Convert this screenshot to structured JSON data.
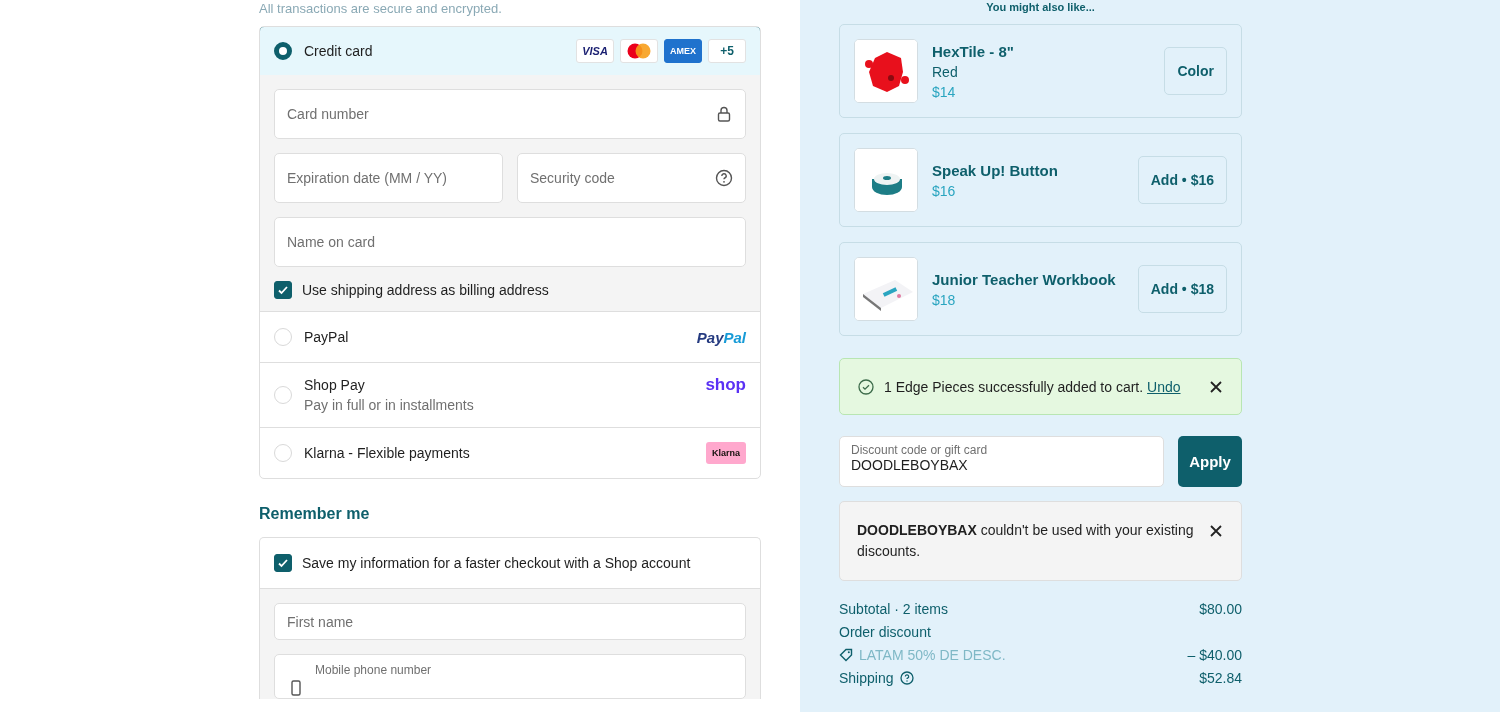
{
  "security_note": "All transactions are secure and encrypted.",
  "payment_methods": [
    {
      "kind": "card",
      "label": "Credit card",
      "selected": true,
      "brands": [
        {
          "kind": "visa",
          "label": "VISA"
        },
        {
          "kind": "mastercard"
        },
        {
          "kind": "amex",
          "label": "AMEX"
        },
        {
          "kind": "more",
          "label": "+5"
        }
      ],
      "fields": [
        [
          {
            "placeholder": "Card number"
          }
        ],
        [
          {
            "placeholder": "Expiration date (MM / YY)"
          },
          {
            "placeholder": "Security code"
          }
        ],
        [
          {
            "placeholder": "Name on card"
          }
        ]
      ],
      "billing_checkbox": {
        "label": "Use shipping address as billing address",
        "checked": true
      }
    },
    {
      "kind": "paypal",
      "label": "PayPal",
      "selected": false,
      "logo": [
        "Pay",
        "Pal"
      ]
    },
    {
      "kind": "shoppay",
      "label": "Shop Pay",
      "sublabel": "Pay in full or in installments",
      "selected": false,
      "logo": [
        "shop"
      ]
    },
    {
      "kind": "klarna",
      "label": "Klarna - Flexible payments",
      "selected": false,
      "logo": [
        "Klarna"
      ]
    }
  ],
  "remember_me": {
    "heading": "Remember me",
    "checkbox": {
      "label": "Save my information for a faster checkout with a Shop account",
      "checked": true
    },
    "fields": [
      {
        "placeholder": "First name"
      },
      {
        "label": "Mobile phone number"
      }
    ]
  },
  "upsell_title": "You might also like...",
  "products": [
    {
      "name": "HexTile - 8\"",
      "variant": "Red",
      "price": "$14",
      "button": "Color"
    },
    {
      "name": "Speak Up! Button",
      "price": "$16",
      "button": "Add • $16"
    },
    {
      "name": "Junior Teacher Workbook",
      "price": "$18",
      "button": "Add • $18"
    }
  ],
  "success_notice": {
    "text": "1 Edge Pieces successfully added to cart.",
    "link": "Undo"
  },
  "discount": {
    "label": "Discount code or gift card",
    "value": "DOODLEBOYBAX",
    "button": "Apply"
  },
  "error_notice": {
    "text": "**DOODLEBOYBAX** couldn't be used with your existing discounts."
  },
  "summary": [
    {
      "kind": "line",
      "label": "Subtotal · 2 items",
      "value": "$80.00"
    },
    {
      "kind": "heading",
      "label": "Order discount"
    },
    {
      "kind": "discount",
      "label": "LATAM 50% DE DESC.",
      "value": "– $40.00"
    },
    {
      "kind": "shipping",
      "label": "Shipping",
      "value": "$52.84"
    }
  ]
}
